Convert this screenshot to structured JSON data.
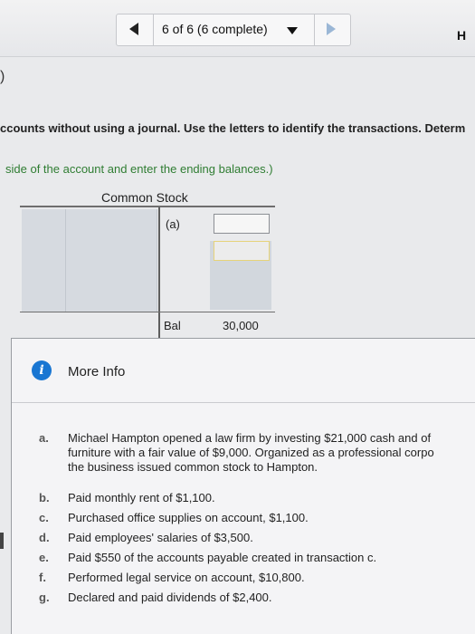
{
  "header": {
    "progress_label": "6 of 6 (6 complete)",
    "brand_partial": "H"
  },
  "question": {
    "fragment_paren": ")",
    "instruction_line": "ccounts without using a journal. Use the letters to identify the transactions. Determ",
    "instruction_line2": "side of the account and enter the ending balances.)"
  },
  "t_account": {
    "title": "Common Stock",
    "entry_label": "(a)",
    "balance_label": "Bal",
    "balance_value": "30,000"
  },
  "more_info": {
    "title": "More Info",
    "items": [
      {
        "letter": "a.",
        "lines": [
          "Michael Hampton opened a law firm by investing $21,000 cash and of",
          "furniture with a fair value of $9,000. Organized as a professional corpo",
          "the business issued common stock to Hampton."
        ]
      },
      {
        "letter": "b.",
        "lines": [
          "Paid monthly rent of $1,100."
        ]
      },
      {
        "letter": "c.",
        "lines": [
          "Purchased office supplies on account, $1,100."
        ]
      },
      {
        "letter": "d.",
        "lines": [
          "Paid employees' salaries of $3,500."
        ]
      },
      {
        "letter": "e.",
        "lines": [
          "Paid $550 of the accounts payable created in transaction c."
        ]
      },
      {
        "letter": "f.",
        "lines": [
          "Performed legal service on account, $10,800."
        ]
      },
      {
        "letter": "g.",
        "lines": [
          "Declared and paid dividends of $2,400."
        ]
      }
    ]
  }
}
